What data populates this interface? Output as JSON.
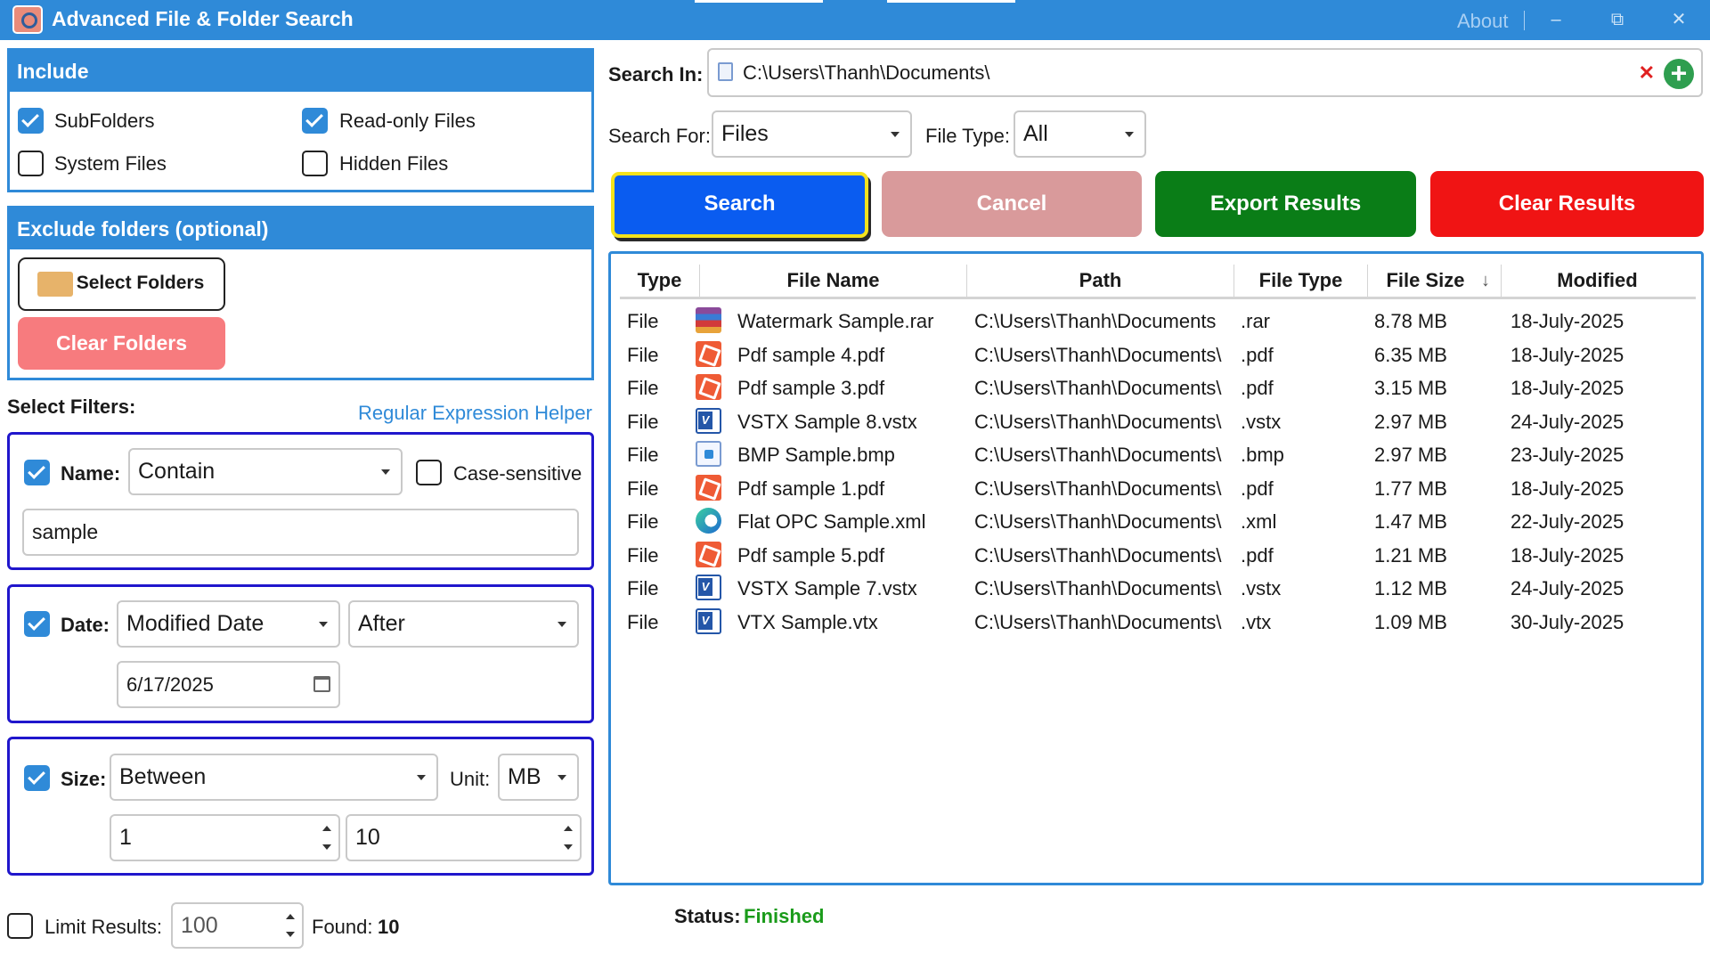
{
  "window": {
    "title": "Advanced File & Folder Search",
    "about": "About"
  },
  "include": {
    "header": "Include",
    "subfolders": "SubFolders",
    "readonly": "Read-only Files",
    "system": "System Files",
    "hidden": "Hidden Files"
  },
  "exclude": {
    "header": "Exclude folders (optional)",
    "select_button": "Select Folders",
    "clear_button": "Clear Folders"
  },
  "filters": {
    "label": "Select Filters:",
    "regex_link": "Regular Expression Helper",
    "name": {
      "label": "Name:",
      "mode": "Contain",
      "case_label": "Case-sensitive",
      "value": "sample"
    },
    "date": {
      "label": "Date:",
      "field": "Modified Date",
      "mode": "After",
      "value": "6/17/2025"
    },
    "size": {
      "label": "Size:",
      "mode": "Between",
      "unit_label": "Unit:",
      "unit": "MB",
      "min": "1",
      "max": "10"
    }
  },
  "limit": {
    "label": "Limit Results:",
    "value": "100",
    "found_label": "Found:",
    "found": "10"
  },
  "search_in": {
    "label": "Search In:",
    "value": "C:\\Users\\Thanh\\Documents\\"
  },
  "search_for": {
    "label": "Search For:",
    "value": "Files"
  },
  "file_type": {
    "label": "File Type:",
    "value": "All"
  },
  "buttons": {
    "search": "Search",
    "cancel": "Cancel",
    "export": "Export Results",
    "clear": "Clear Results"
  },
  "table": {
    "headers": [
      "Type",
      "File Name",
      "Path",
      "File Type",
      "File Size",
      "Modified"
    ],
    "rows": [
      {
        "type": "File",
        "name": "Watermark Sample.rar",
        "path": "C:\\Users\\Thanh\\Documents",
        "ext": ".rar",
        "size": "8.78 MB",
        "modified": "18-July-2025",
        "icon": "rar-icon"
      },
      {
        "type": "File",
        "name": "Pdf sample 4.pdf",
        "path": "C:\\Users\\Thanh\\Documents\\",
        "ext": ".pdf",
        "size": "6.35 MB",
        "modified": "18-July-2025",
        "icon": "pdf-icon"
      },
      {
        "type": "File",
        "name": "Pdf sample 3.pdf",
        "path": "C:\\Users\\Thanh\\Documents\\",
        "ext": ".pdf",
        "size": "3.15 MB",
        "modified": "18-July-2025",
        "icon": "pdf-icon"
      },
      {
        "type": "File",
        "name": "VSTX Sample 8.vstx",
        "path": "C:\\Users\\Thanh\\Documents\\",
        "ext": ".vstx",
        "size": "2.97 MB",
        "modified": "24-July-2025",
        "icon": "visio-icon"
      },
      {
        "type": "File",
        "name": "BMP Sample.bmp",
        "path": "C:\\Users\\Thanh\\Documents\\",
        "ext": ".bmp",
        "size": "2.97 MB",
        "modified": "23-July-2025",
        "icon": "image-icon"
      },
      {
        "type": "File",
        "name": "Pdf sample 1.pdf",
        "path": "C:\\Users\\Thanh\\Documents\\",
        "ext": ".pdf",
        "size": "1.77 MB",
        "modified": "18-July-2025",
        "icon": "pdf-icon"
      },
      {
        "type": "File",
        "name": "Flat OPC Sample.xml",
        "path": "C:\\Users\\Thanh\\Documents\\",
        "ext": ".xml",
        "size": "1.47 MB",
        "modified": "22-July-2025",
        "icon": "edge-icon"
      },
      {
        "type": "File",
        "name": "Pdf sample 5.pdf",
        "path": "C:\\Users\\Thanh\\Documents\\",
        "ext": ".pdf",
        "size": "1.21 MB",
        "modified": "18-July-2025",
        "icon": "pdf-icon"
      },
      {
        "type": "File",
        "name": "VSTX Sample 7.vstx",
        "path": "C:\\Users\\Thanh\\Documents\\",
        "ext": ".vstx",
        "size": "1.12 MB",
        "modified": "24-July-2025",
        "icon": "visio-icon"
      },
      {
        "type": "File",
        "name": "VTX Sample.vtx",
        "path": "C:\\Users\\Thanh\\Documents\\",
        "ext": ".vtx",
        "size": "1.09 MB",
        "modified": "30-July-2025",
        "icon": "visio-icon"
      }
    ]
  },
  "status": {
    "label": "Status:",
    "value": "Finished"
  },
  "colors": {
    "accent": "#2f8ad8",
    "search": "#0a5cf0",
    "cancel": "#d99a9b",
    "export": "#0a7d17",
    "clear": "#f01414",
    "clear_folders": "#f77b7e",
    "status_ok": "#1a9b1a",
    "filter_border": "#2016cc"
  }
}
